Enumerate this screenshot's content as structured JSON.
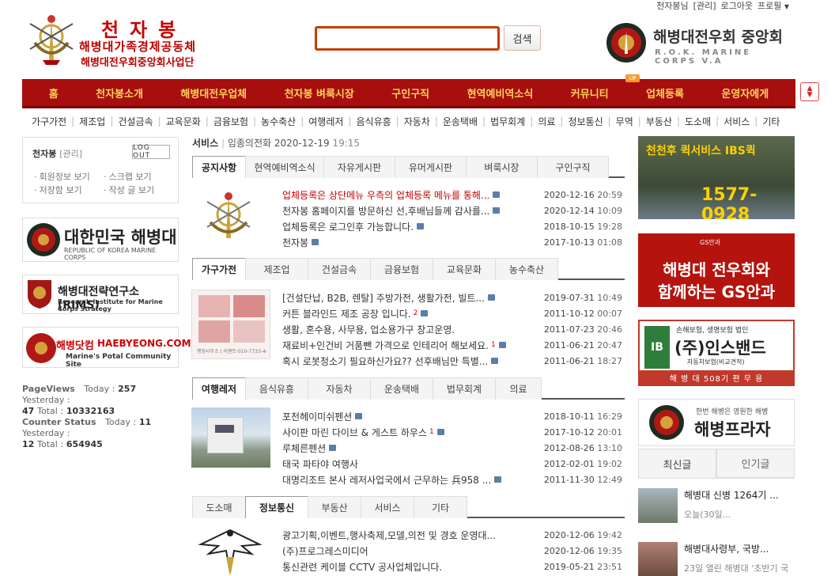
{
  "util": [
    "천자봉님",
    "[관리]",
    "로그아웃",
    "프로필"
  ],
  "header": {
    "left_title": "천자봉",
    "left_sub1": "해병대가족경제공동체",
    "left_sub2": "해병대전우회중앙회사업단",
    "search_btn": "검색",
    "right_title": "해병대전우회 중앙회",
    "right_sub": "R.O.K. MARINE CORPS V.A"
  },
  "mainnav": [
    "홈",
    "천자봉소개",
    "해병대전우업체",
    "천자봉 벼룩시장",
    "구인구직",
    "현역예비역소식",
    "커뮤니티",
    "업체등록",
    "운영자에게"
  ],
  "up_badge": "UP",
  "subnav": [
    "가구가전",
    "제조업",
    "건설금속",
    "교육문화",
    "금융보험",
    "농수축산",
    "여행레저",
    "음식유흥",
    "자동차",
    "운송택배",
    "법무회계",
    "의료",
    "정보통신",
    "무역",
    "부동산",
    "도소매",
    "서비스",
    "기타"
  ],
  "login": {
    "name": "천자봉",
    "manage": "[관리]",
    "logout": "LOG OUT",
    "links": [
      "회원정보 보기",
      "스크랩 보기",
      "저장함 보기",
      "작성 글 보기"
    ]
  },
  "left_banners": [
    {
      "title": "대한민국 해병대",
      "sub": "REPUBLIC OF KOREA MARINE CORPS"
    },
    {
      "title": "해병대전략연구소(RIMS)",
      "sub": "Research Institute for Marine Corps Strategy"
    },
    {
      "title": "해병닷컴",
      "title2": "HAEBYEONG.COM",
      "sub": "Marine's Potal Community Site"
    }
  ],
  "counter": {
    "pv_label": "PageViews",
    "today_label": "Today :",
    "today": "257",
    "yest_label": "Yesterday :",
    "yest": "47",
    "total_label": "Total :",
    "total": "10332163",
    "cs_label": "Counter Status",
    "cs_today": "11",
    "cs_yest": "12",
    "cs_total": "654945"
  },
  "breadcrumb": {
    "cat": "서비스",
    "sep": "|",
    "name": "임종의전화",
    "date": "2020-12-19",
    "time": "19:15"
  },
  "section1": {
    "tabs": [
      "공지사항",
      "현역예비역소식",
      "자유게시판",
      "유머게시판",
      "벼룩시장",
      "구인구직"
    ],
    "rows": [
      {
        "t": "업체등록은 상단메뉴 우측의 업체등록 메뉴를 통해...",
        "d": "2020-12-16",
        "tm": "20:59",
        "red": true
      },
      {
        "t": "천자봉 홈페이지를 방문하신 선,후배님들께 감사를...",
        "d": "2020-12-14",
        "tm": "10:09"
      },
      {
        "t": "업체등록은 로그인후 가능합니다.",
        "d": "2018-10-15",
        "tm": "19:28"
      },
      {
        "t": "천자봉",
        "d": "2017-10-13",
        "tm": "01:08"
      }
    ]
  },
  "section2": {
    "tabs": [
      "가구가전",
      "제조업",
      "건설금속",
      "금융보험",
      "교육문화",
      "농수축산"
    ],
    "rows": [
      {
        "t": "[건설단납, B2B, 렌탈] 주방가전, 생활가전, 빌트...",
        "d": "2019-07-31",
        "tm": "10:49"
      },
      {
        "t": "커튼 블라인드 제조 공장 입니다.",
        "c": "2",
        "d": "2011-10-12",
        "tm": "00:07"
      },
      {
        "t": "생활, 혼수용, 사무용, 업소용가구 창고운영.",
        "d": "2011-07-23",
        "tm": "20:46"
      },
      {
        "t": "재료비+인건비 거품뺀 가격으로 인테리어 해보세요.",
        "c": "1",
        "d": "2011-06-21",
        "tm": "20:47"
      },
      {
        "t": "혹시 로봇청소기 필요하신가요?? 선후배님만 특별...",
        "d": "2011-06-21",
        "tm": "18:27"
      }
    ]
  },
  "section3": {
    "tabs": [
      "여행레저",
      "음식유흥",
      "자동차",
      "운송택배",
      "법무회계",
      "의료"
    ],
    "rows": [
      {
        "t": "포천헤이미쉬펜션",
        "d": "2018-10-11",
        "tm": "16:29"
      },
      {
        "t": "사이판 마린 다이브 & 게스트 하우스",
        "c": "1",
        "d": "2017-10-12",
        "tm": "20:01"
      },
      {
        "t": "루체른펜션",
        "d": "2012-08-26",
        "tm": "13:10"
      },
      {
        "t": "태국 파타야 여행사",
        "d": "2012-02-01",
        "tm": "19:02"
      },
      {
        "t": "대명리조트 본사 레저사업국에서 근무하는 兵958 ...",
        "d": "2011-11-30",
        "tm": "12:49"
      }
    ]
  },
  "section4": {
    "tabs": [
      "도소매",
      "정보통신",
      "부동산",
      "서비스",
      "기타"
    ],
    "rows": [
      {
        "t": "광고기획,이벤트,행사축제,모델,의전 및 경호 운영대...",
        "d": "2020-12-06",
        "tm": "19:42"
      },
      {
        "t": "(주)프로그레스미디어",
        "d": "2020-12-06",
        "tm": "19:35"
      },
      {
        "t": "통신관련 케이블 CCTV 공사업체입니다.",
        "d": "2019-05-21",
        "tm": "23:51"
      }
    ]
  },
  "thumb2_text": "행정사무소 | 이벤트·010-7733-4412",
  "right_banners": {
    "b1_t1": "천천후 퀵서비스 IBS퀵",
    "b1_t2": "1577-0928",
    "b2_top": "GS안과",
    "b2_t1": "해병대 전우회와",
    "b2_t2": "함께하는 GS안과",
    "b3_top": "손해보험, 생명보험 법인",
    "b3_title": "(주)인스밴드",
    "b3_sub": "자동차보험(비교견적)",
    "b3_bottom": "해 병 대 508기 편 무 용",
    "b4_sub": "한번 해병은 영원한 해병",
    "b4_title": "해병프라자"
  },
  "right_tabs": [
    "최신글",
    "인기글"
  ],
  "right_list": [
    {
      "t": "해병대 신병 1264기 ...",
      "s": "오늘(30일..."
    },
    {
      "t": "해병대사령부, 국방...",
      "s": "23일 열린 해병대 '초반기 국"
    }
  ],
  "colors": {
    "nav": "#a70f0f",
    "nav_text": "#ffd35a",
    "accent": "#c83c00"
  }
}
